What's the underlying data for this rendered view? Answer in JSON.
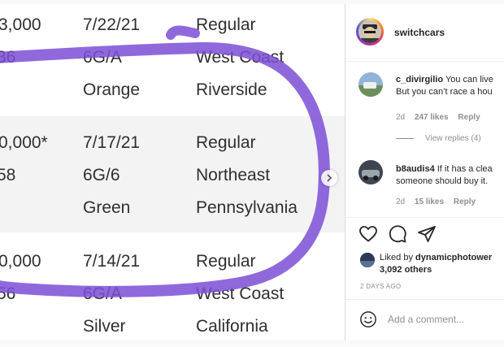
{
  "table": {
    "rows": [
      {
        "amount": "3,000",
        "code": "36",
        "date": "7/22/21",
        "type": "Regular",
        "spec": "6G/A",
        "region": "West Coast",
        "color": "Orange",
        "location": "Riverside"
      },
      {
        "amount": "0,000*",
        "code": "58",
        "date": "7/17/21",
        "type": "Regular",
        "spec": "6G/6",
        "region": "Northeast",
        "color": "Green",
        "location": "Pennsylvania"
      },
      {
        "amount": "0,000",
        "code": "56",
        "date": "7/14/21",
        "type": "Regular",
        "spec": "6G/A",
        "region": "West Coast",
        "color": "Silver",
        "location": "California"
      }
    ]
  },
  "annotation": {
    "color": "#7b4fd6"
  },
  "post": {
    "username": "switchcars",
    "comments": [
      {
        "user": "c_divirgilio",
        "line1": "You can live",
        "line2": "But you can’t race a hou",
        "age": "2d",
        "likes": "247 likes",
        "reply": "Reply",
        "view_replies": "View replies (4)"
      },
      {
        "user": "b8audis4",
        "line1": "If it has a clea",
        "line2": "someone should buy it.",
        "age": "2d",
        "likes": "15 likes",
        "reply": "Reply"
      }
    ],
    "liked_prefix": "Liked by",
    "liked_user": "dynamicphotower",
    "liked_others": "3,092 others",
    "timestamp": "2 DAYS AGO",
    "comment_placeholder": "Add a comment..."
  },
  "icons": {
    "like": "heart-icon",
    "comment": "comment-icon",
    "share": "share-icon",
    "emoji": "emoji-icon",
    "next": "chevron-right-icon"
  },
  "colors": {
    "link": "#262626",
    "muted": "#8e8e8e",
    "border": "#dbdbdb"
  }
}
